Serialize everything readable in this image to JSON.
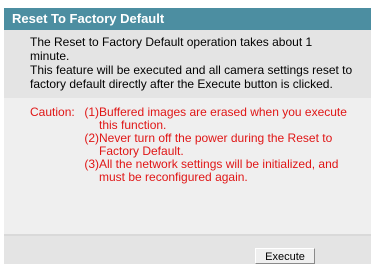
{
  "header": {
    "title": "Reset To Factory Default"
  },
  "description": {
    "lines": [
      "The Reset to Factory Default operation takes about 1",
      "minute.",
      "This feature will be executed and all camera settings reset to",
      "factory default directly after the Execute button is clicked."
    ]
  },
  "caution": {
    "label": "Caution:",
    "items": [
      {
        "number": "(1)",
        "lines": [
          "Buffered images are erased when you execute",
          "this function."
        ]
      },
      {
        "number": "(2)",
        "lines": [
          "Never turn off the power during the Reset to",
          "Factory Default."
        ]
      },
      {
        "number": "(3)",
        "lines": [
          "All the network settings will be initialized, and",
          "must be reconfigured again."
        ]
      }
    ]
  },
  "footer": {
    "execute_label": "Execute"
  },
  "colors": {
    "title_bar": "#4c8ea1",
    "caution_text": "#e01616",
    "panel_bg": "#efefef"
  }
}
